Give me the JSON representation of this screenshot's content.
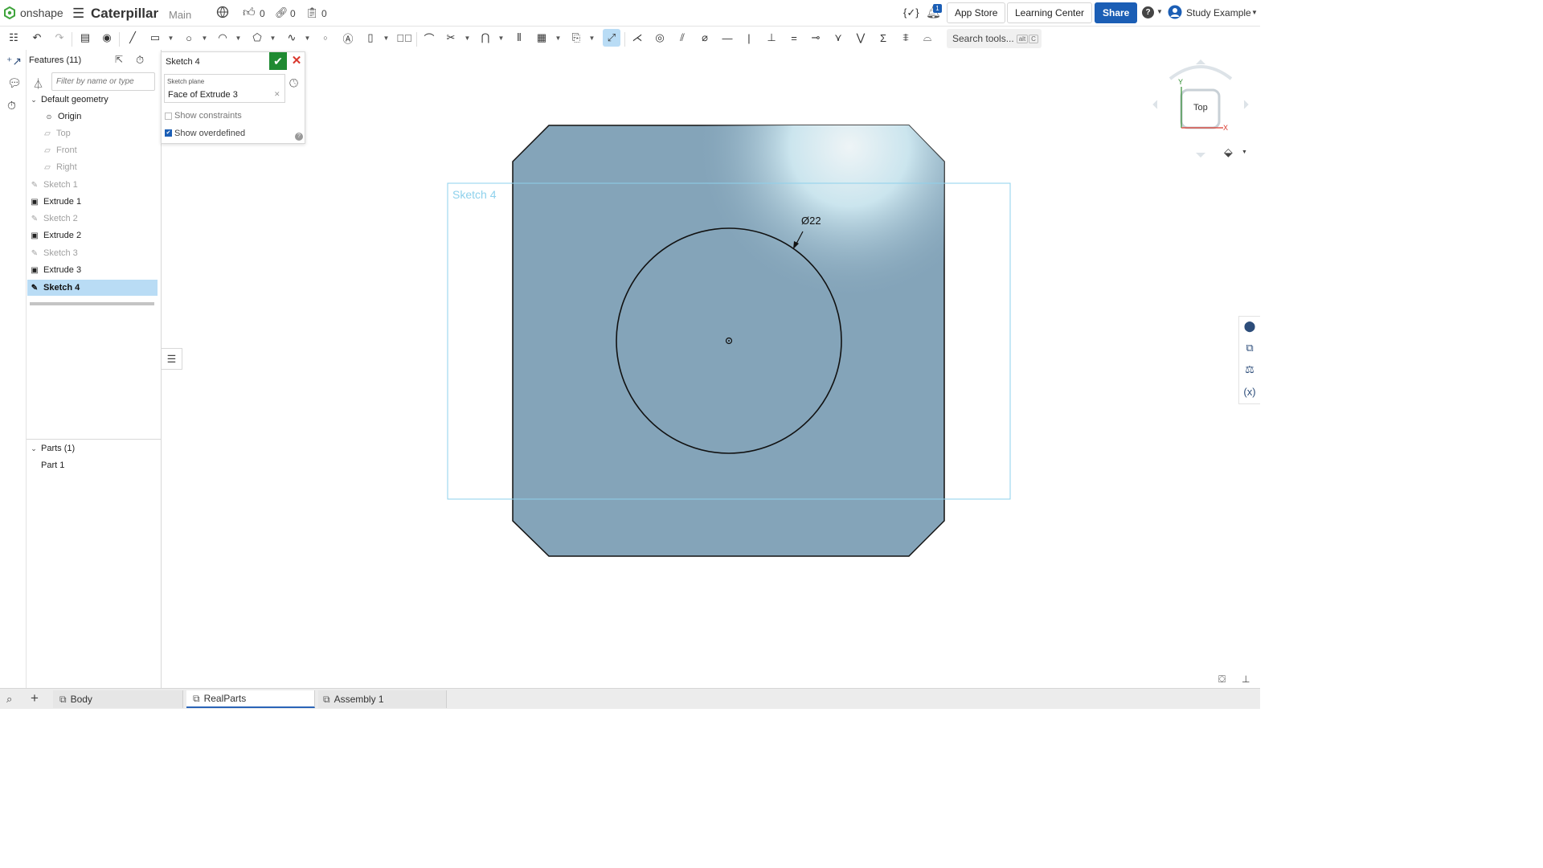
{
  "app": {
    "logo_text": "onshape",
    "title": "Caterpillar",
    "branch": "Main"
  },
  "topbar": {
    "likes": "0",
    "links": "0",
    "copies": "0",
    "notifications": "1",
    "app_store": "App Store",
    "learning_center": "Learning Center",
    "share": "Share",
    "user": "Study Example"
  },
  "toolbar": {
    "search_placeholder": "Search tools...",
    "search_shortcut_1": "alt",
    "search_shortcut_2": "C"
  },
  "features": {
    "header": "Features (11)",
    "filter_placeholder": "Filter by name or type",
    "items": [
      {
        "label": "Default geometry"
      },
      {
        "label": "Origin"
      },
      {
        "label": "Top"
      },
      {
        "label": "Front"
      },
      {
        "label": "Right"
      },
      {
        "label": "Sketch 1"
      },
      {
        "label": "Extrude 1"
      },
      {
        "label": "Sketch 2"
      },
      {
        "label": "Extrude 2"
      },
      {
        "label": "Sketch 3"
      },
      {
        "label": "Extrude 3"
      },
      {
        "label": "Sketch 4"
      }
    ],
    "parts_header": "Parts (1)",
    "parts": [
      {
        "label": "Part 1"
      }
    ]
  },
  "sketch_dialog": {
    "title": "Sketch 4",
    "plane_label": "Sketch plane",
    "plane_value": "Face of Extrude 3",
    "show_constraints": "Show constraints",
    "show_constraints_checked": false,
    "show_overdefined": "Show overdefined",
    "show_overdefined_checked": true
  },
  "viewport": {
    "sketch_label": "Sketch 4",
    "dimension": "Ø22",
    "view_cube_label": "Top",
    "axis_y": "Y",
    "axis_x": "X",
    "part_color": "#84a4b9",
    "accent_color": "#1b5eb5"
  },
  "tabs": [
    {
      "label": "Body"
    },
    {
      "label": "RealParts"
    },
    {
      "label": "Assembly 1"
    }
  ]
}
